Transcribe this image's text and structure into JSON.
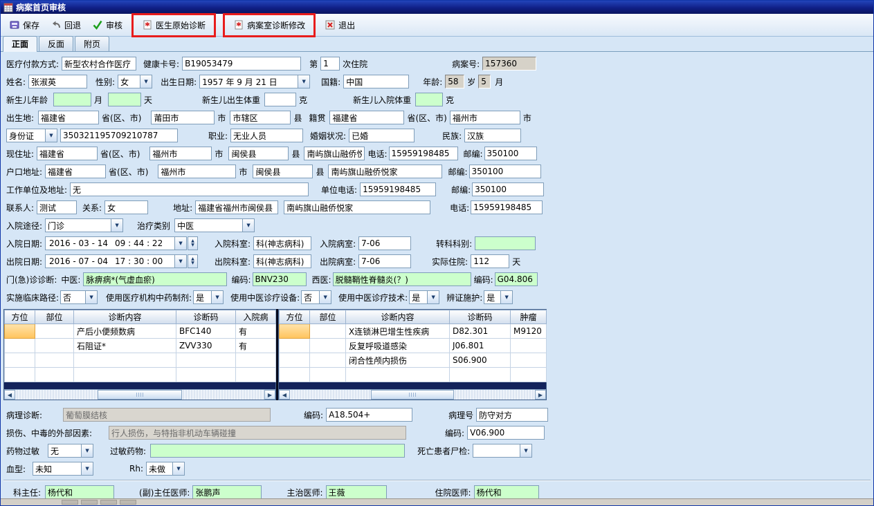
{
  "window": {
    "title": "病案首页审核"
  },
  "colors": {
    "titlebar_blue": "#101f86",
    "field_green": "#ccffcc",
    "row_highlight_orange": "#ffc35c",
    "annotation_red": "#e81c1c"
  },
  "toolbar": {
    "save": "保存",
    "undo": "回退",
    "audit": "审核",
    "doctor_diag": "医生原始诊断",
    "record_modify": "病案室诊断修改",
    "exit": "退出"
  },
  "tabs": {
    "front": "正面",
    "back": "反面",
    "appendix": "附页"
  },
  "fields": {
    "payment_label": "医疗付款方式:",
    "payment": "新型农村合作医疗",
    "card_label": "健康卡号:",
    "card": "B19053479",
    "nth_pre": "第",
    "nth": "1",
    "nth_post": "次住院",
    "mrn_label": "病案号:",
    "mrn": "157360",
    "name_label": "姓名:",
    "name": "张淑英",
    "sex_label": "性别:",
    "sex": "女",
    "dob_label": "出生日期:",
    "dob": "1957 年 9 月 21 日",
    "nationality_label": "国籍:",
    "nationality": "中国",
    "age_label": "年龄:",
    "age_years": "58",
    "age_y_unit": "岁",
    "age_months": "5",
    "age_m_unit": "月",
    "nb_age_label": "新生儿年龄",
    "nb_months": "",
    "nb_month_unit": "月",
    "nb_days": "",
    "nb_day_unit": "天",
    "nb_birth_weight_label": "新生儿出生体重",
    "nb_birth_weight": "",
    "nb_weight_unit": "克",
    "nb_adm_weight_label": "新生儿入院体重",
    "nb_adm_weight": "",
    "birthplace_label": "出生地:",
    "birthplace_province": "福建省",
    "province_suffix": "省(区、市)",
    "birthplace_city": "莆田市",
    "city_suffix": "市",
    "birthplace_county": "市辖区",
    "county_suffix": "县",
    "native_label": "籍贯",
    "native_province": "福建省",
    "native_city": "福州市",
    "id_type": "身份证",
    "id_number": "350321195709210787",
    "occupation_label": "职业:",
    "occupation": "无业人员",
    "marital_label": "婚姻状况:",
    "marital": "已婚",
    "ethnic_label": "民族:",
    "ethnic": "汉族",
    "cur_addr_label": "现住址:",
    "cur_province": "福建省",
    "cur_city": "福州市",
    "cur_county": "闽侯县",
    "cur_detail": "南屿旗山融侨悦家",
    "phone_label": "电话:",
    "cur_phone": "15959198485",
    "zip_label": "邮编:",
    "cur_zip": "350100",
    "reg_addr_label": "户口地址:",
    "reg_province": "福建省",
    "reg_city": "福州市",
    "reg_county": "闽侯县",
    "reg_detail": "南屿旗山融侨悦家",
    "reg_zip": "350100",
    "work_label": "工作单位及地址:",
    "work": "无",
    "work_phone_label": "单位电话:",
    "work_phone": "15959198485",
    "work_zip": "350100",
    "contact_label": "联系人:",
    "contact": "测试",
    "relation_label": "关系:",
    "relation": "女",
    "contact_addr_label": "地址:",
    "contact_addr1": "福建省福州市闽侯县",
    "contact_addr2": "南屿旗山融侨悦家",
    "contact_phone": "15959198485",
    "adm_path_label": "入院途径:",
    "adm_path": "门诊",
    "treat_type_label": "治疗类别",
    "treat_type": "中医",
    "adm_date_label": "入院日期:",
    "adm_date": "2016 - 03 - 14",
    "adm_time": "09 : 44 : 22",
    "adm_dept_label": "入院科室:",
    "adm_dept": "科(神志病科)",
    "adm_ward_label": "入院病室:",
    "adm_ward": "7-06",
    "transfer_label": "转科科别:",
    "transfer": "",
    "dis_date_label": "出院日期:",
    "dis_date": "2016 - 07 - 04",
    "dis_time": "17 : 30 : 00",
    "dis_dept_label": "出院科室:",
    "dis_dept": "科(神志病科)",
    "dis_ward_label": "出院病室:",
    "dis_ward": "7-06",
    "stay_label": "实际住院:",
    "stay_days": "112",
    "stay_unit": "天",
    "outpatient_label": "门(急)诊诊断:",
    "tcm_label": "中医:",
    "tcm_diag": "脉痹病*(气虚血瘀)",
    "code_label": "编码:",
    "tcm_code": "BNV230",
    "west_label": "西医:",
    "west_diag": "脱髓鞘性脊髓炎(？)",
    "west_code": "G04.806",
    "path_label": "实施临床路径:",
    "path_val": "否",
    "herb_label": "使用医疗机构中药制剂:",
    "herb_val": "是",
    "equip_label": "使用中医诊疗设备:",
    "equip_val": "否",
    "tech_label": "使用中医诊疗技术:",
    "tech_val": "是",
    "syndrome_label": "辨证施护:",
    "syndrome_val": "是"
  },
  "diag_tables": {
    "left": {
      "headers": [
        "方位",
        "部位",
        "诊断内容",
        "诊断码",
        "入院病"
      ],
      "rows": [
        [
          "",
          "",
          "产后小便频数病",
          "BFC140",
          "有"
        ],
        [
          "",
          "",
          "石阻证*",
          "ZVV330",
          "有"
        ],
        [
          "",
          "",
          "",
          "",
          ""
        ],
        [
          "",
          "",
          "",
          "",
          ""
        ]
      ]
    },
    "right": {
      "headers": [
        "方位",
        "部位",
        "诊断内容",
        "诊断码",
        "肿瘤"
      ],
      "rows": [
        [
          "",
          "",
          "X连锁淋巴增生性疾病",
          "D82.301",
          "M9120"
        ],
        [
          "",
          "",
          "反复呼吸道感染",
          "J06.801",
          ""
        ],
        [
          "",
          "",
          "闭合性颅内损伤",
          "S06.900",
          ""
        ],
        [
          "",
          "",
          "",
          "",
          ""
        ]
      ]
    }
  },
  "bottom": {
    "pathology_label": "病理诊断:",
    "pathology": "葡萄膜结核",
    "pathology_code_label": "编码:",
    "pathology_code": "A18.504+",
    "pathology_no_label": "病理号",
    "pathology_no": "防守对方",
    "injury_label": "损伤、中毒的外部因素:",
    "injury": "行人损伤，与特指非机动车辆碰撞",
    "injury_code_label": "编码:",
    "injury_code": "V06.900",
    "allergy_label": "药物过敏",
    "allergy": "无",
    "allergy_drug_label": "过敏药物:",
    "allergy_drug": "",
    "autopsy_label": "死亡患者尸检:",
    "autopsy": "",
    "blood_label": "血型:",
    "blood": "未知",
    "rh_label": "Rh:",
    "rh": "未做",
    "chief_label": "科主任:",
    "chief": "杨代和",
    "deputy_label": "(副)主任医师:",
    "deputy": "张鹏声",
    "attending_label": "主治医师:",
    "attending": "王薇",
    "resident_label": "住院医师:",
    "resident": "杨代和"
  }
}
